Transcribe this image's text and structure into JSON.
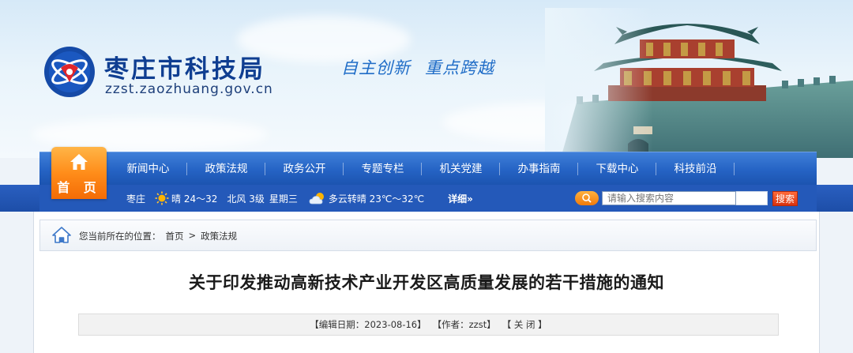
{
  "header": {
    "site_name": "枣庄市科技局",
    "site_domain": "zzst.zaozhuang.gov.cn",
    "slogan_part1": "自主创新",
    "slogan_part2": "重点跨越"
  },
  "nav": {
    "home_label": "首 页",
    "items": [
      "新闻中心",
      "政策法规",
      "政务公开",
      "专题专栏",
      "机关党建",
      "办事指南",
      "下载中心",
      "科技前沿"
    ]
  },
  "weather": {
    "city": "枣庄",
    "today": "晴 24～32",
    "wind": "北风 3级",
    "weekday": "星期三",
    "tomorrow": "多云转晴 23℃～32℃",
    "more": "详细»"
  },
  "search": {
    "placeholder": "请输入搜索内容",
    "button": "搜索"
  },
  "breadcrumb": {
    "prefix": "您当前所在的位置：",
    "home": "首页",
    "separator": ">",
    "current": "政策法规"
  },
  "article": {
    "title": "关于印发推动高新技术产业开发区高质量发展的若干措施的通知",
    "date": "【编辑日期：2023-08-16】",
    "author": "【作者：zzst】",
    "close": "【 关 闭 】"
  },
  "colors": {
    "nav_blue": "#2563c4",
    "home_orange": "#ff8d1a",
    "brand_blue": "#0f3e91",
    "slogan_blue": "#1f6cc7"
  }
}
